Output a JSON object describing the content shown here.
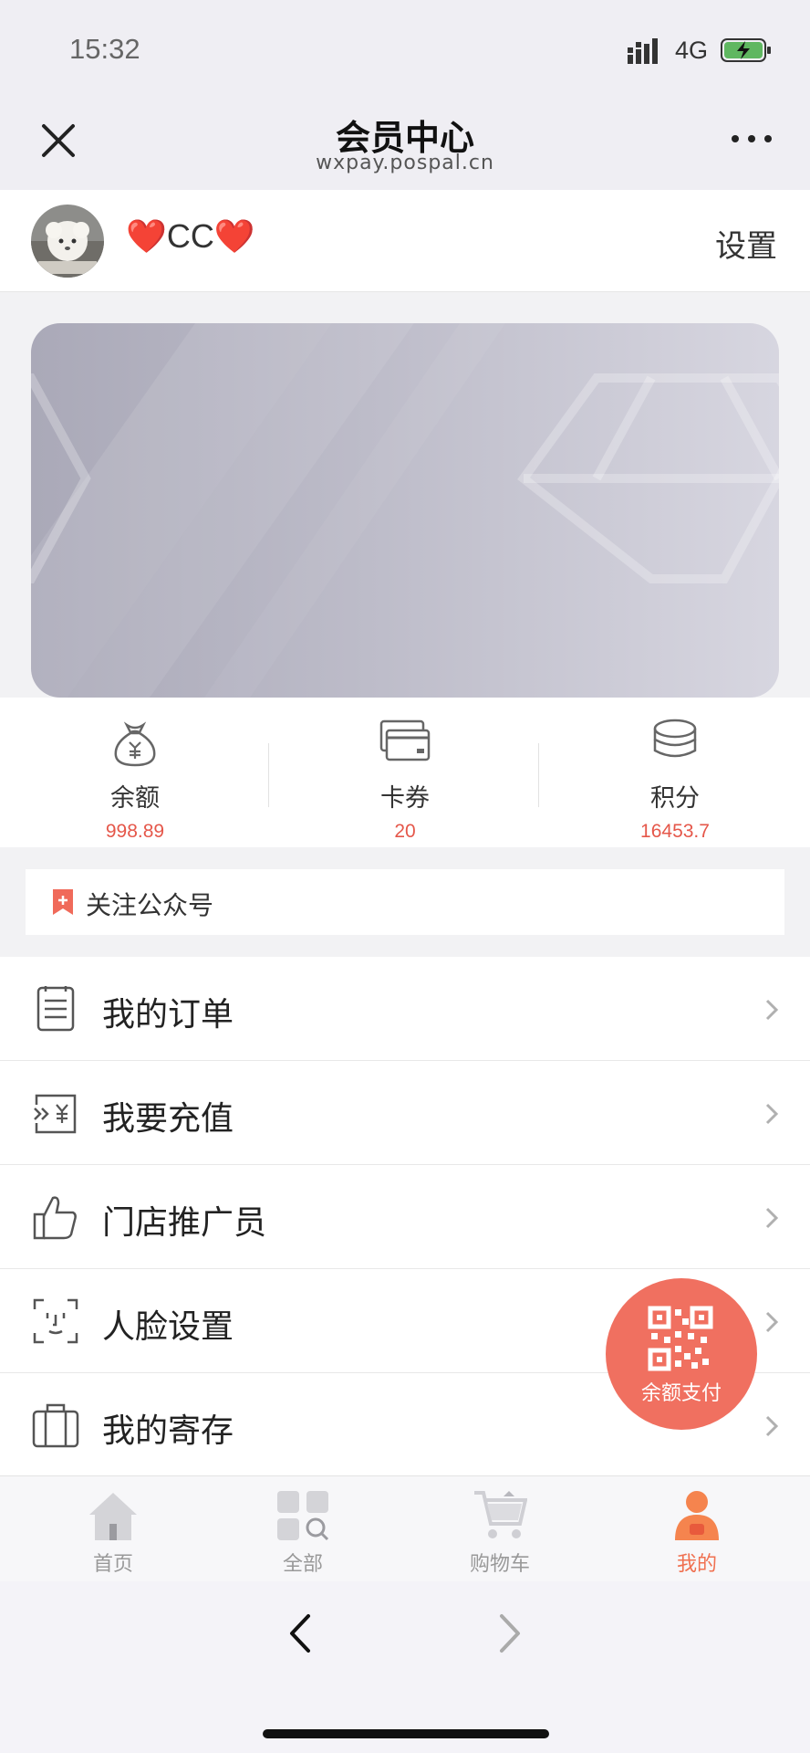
{
  "status": {
    "time": "15:32",
    "network": "4G"
  },
  "nav": {
    "title": "会员中心",
    "subtitle": "wxpay.pospal.cn"
  },
  "profile": {
    "name": "❤️CC❤️",
    "settings_label": "设置"
  },
  "stats": [
    {
      "label": "余额",
      "value": "998.89",
      "icon": "money-bag-icon"
    },
    {
      "label": "卡券",
      "value": "20",
      "icon": "card-icon"
    },
    {
      "label": "积分",
      "value": "16453.7",
      "icon": "coins-icon"
    }
  ],
  "follow": {
    "label": "关注公众号",
    "icon": "bookmark-plus-icon"
  },
  "menu": [
    {
      "label": "我的订单",
      "icon": "clipboard-icon"
    },
    {
      "label": "我要充值",
      "icon": "recharge-icon"
    },
    {
      "label": "门店推广员",
      "icon": "thumbs-up-icon"
    },
    {
      "label": "人脸设置",
      "icon": "face-scan-icon"
    },
    {
      "label": "我的寄存",
      "icon": "locker-icon"
    }
  ],
  "fab": {
    "label": "余额支付",
    "icon": "qr-code-icon"
  },
  "tabs": [
    {
      "label": "首页",
      "icon": "home-icon",
      "active": false
    },
    {
      "label": "全部",
      "icon": "grid-search-icon",
      "active": false
    },
    {
      "label": "购物车",
      "icon": "cart-icon",
      "active": false
    },
    {
      "label": "我的",
      "icon": "user-icon",
      "active": true
    }
  ],
  "colors": {
    "accent": "#f07060",
    "value_red": "#e5574a",
    "tab_inactive": "#999999"
  }
}
